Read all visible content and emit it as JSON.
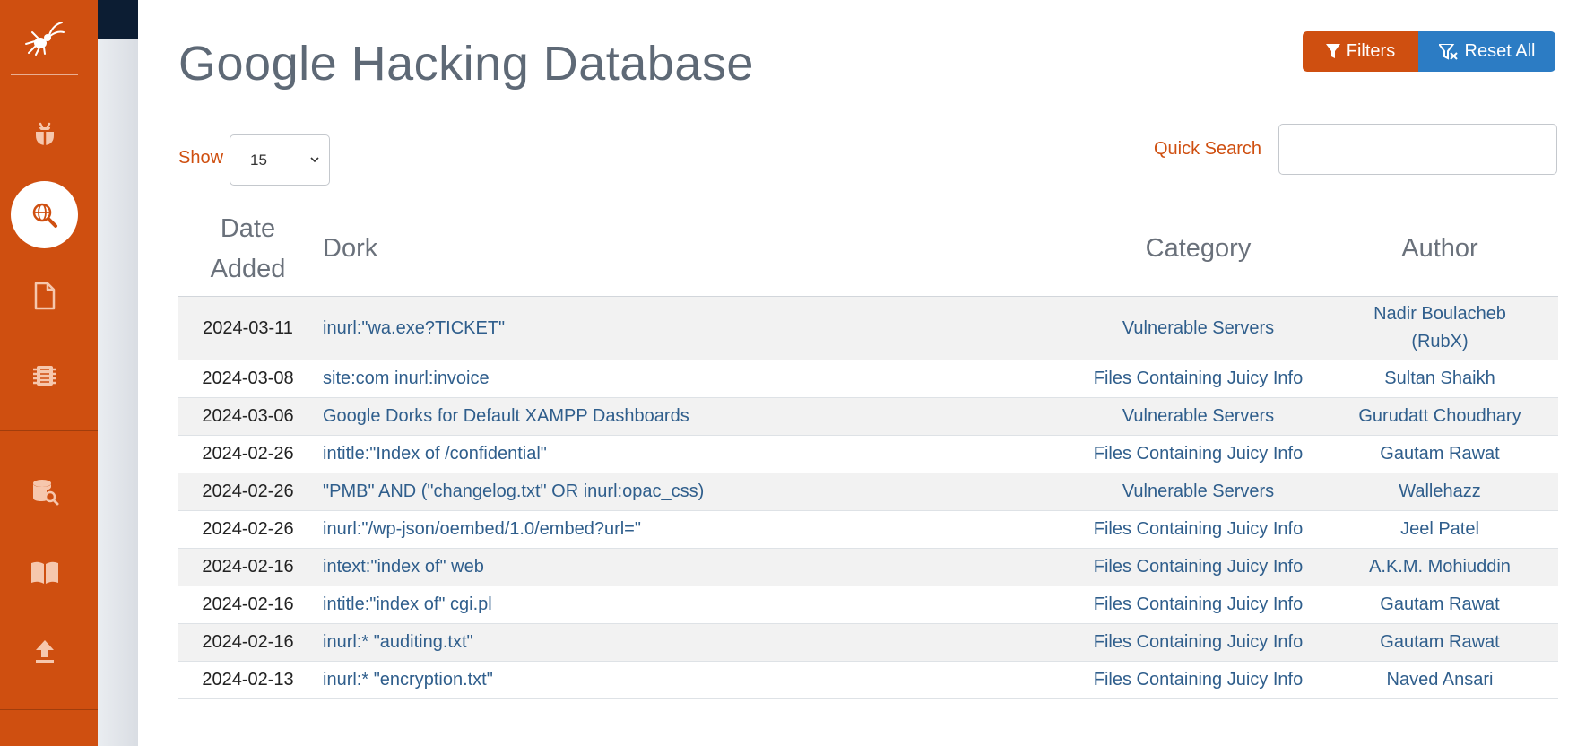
{
  "page": {
    "title": "Google Hacking Database"
  },
  "toolbar": {
    "filters_label": "Filters",
    "reset_label": "Reset All",
    "filters_color": "#cf4f10",
    "reset_color": "#2c7cc4"
  },
  "controls": {
    "show_label": "Show",
    "show_value": "15",
    "quick_search_label": "Quick Search",
    "quick_search_value": ""
  },
  "sidebar": {
    "color": "#cf4f10",
    "items": [
      {
        "icon": "bug-icon"
      },
      {
        "icon": "globe-search-icon",
        "active": true
      },
      {
        "icon": "document-icon"
      },
      {
        "icon": "chip-icon"
      },
      {
        "icon": "database-search-icon"
      },
      {
        "icon": "book-icon"
      },
      {
        "icon": "upload-icon"
      }
    ]
  },
  "table": {
    "columns": [
      "Date Added",
      "Dork",
      "Category",
      "Author"
    ],
    "rows": [
      {
        "date": "2024-03-11",
        "dork": "inurl:\"wa.exe?TICKET\"",
        "category": "Vulnerable Servers",
        "author": "Nadir Boulacheb (RubX)"
      },
      {
        "date": "2024-03-08",
        "dork": "site:com inurl:invoice",
        "category": "Files Containing Juicy Info",
        "author": "Sultan Shaikh"
      },
      {
        "date": "2024-03-06",
        "dork": "Google Dorks for Default XAMPP Dashboards",
        "category": "Vulnerable Servers",
        "author": "Gurudatt Choudhary"
      },
      {
        "date": "2024-02-26",
        "dork": "intitle:\"Index of /confidential\"",
        "category": "Files Containing Juicy Info",
        "author": "Gautam Rawat"
      },
      {
        "date": "2024-02-26",
        "dork": "\"PMB\" AND (\"changelog.txt\" OR inurl:opac_css)",
        "category": "Vulnerable Servers",
        "author": "Wallehazz"
      },
      {
        "date": "2024-02-26",
        "dork": "inurl:\"/wp-json/oembed/1.0/embed?url=\"",
        "category": "Files Containing Juicy Info",
        "author": "Jeel Patel"
      },
      {
        "date": "2024-02-16",
        "dork": "intext:\"index of\" web",
        "category": "Files Containing Juicy Info",
        "author": "A.K.M. Mohiuddin"
      },
      {
        "date": "2024-02-16",
        "dork": "intitle:\"index of\" cgi.pl",
        "category": "Files Containing Juicy Info",
        "author": "Gautam Rawat"
      },
      {
        "date": "2024-02-16",
        "dork": "inurl:* \"auditing.txt\"",
        "category": "Files Containing Juicy Info",
        "author": "Gautam Rawat"
      },
      {
        "date": "2024-02-13",
        "dork": "inurl:* \"encryption.txt\"",
        "category": "Files Containing Juicy Info",
        "author": "Naved Ansari"
      }
    ]
  }
}
